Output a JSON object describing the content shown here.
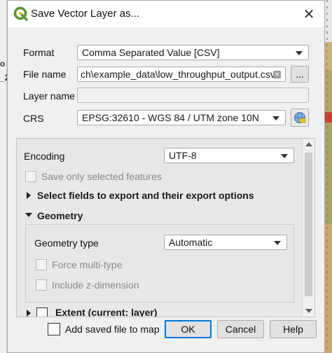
{
  "window": {
    "title": "Save Vector Layer as..."
  },
  "background": {
    "left_fragments": [
      "o",
      "_2"
    ]
  },
  "fields": {
    "format_label": "Format",
    "format_value": "Comma Separated Value [CSV]",
    "filename_label": "File name",
    "filename_value": "ch\\example_data\\low_throughput_output.csv",
    "browse_label": "...",
    "layername_label": "Layer name",
    "layername_value": "",
    "crs_label": "CRS",
    "crs_value": "EPSG:32610 - WGS 84 / UTM zone 10N"
  },
  "options": {
    "encoding_label": "Encoding",
    "encoding_value": "UTF-8",
    "save_selected_label": "Save only selected features",
    "select_fields_label": "Select fields to export and their export options",
    "geometry_label": "Geometry",
    "geometry_type_label": "Geometry type",
    "geometry_type_value": "Automatic",
    "force_multi_label": "Force multi-type",
    "include_z_label": "Include z-dimension",
    "extent_label": "Extent (current: layer)"
  },
  "footer": {
    "add_saved_label": "Add saved file to map",
    "ok_label": "OK",
    "cancel_label": "Cancel",
    "help_label": "Help"
  },
  "colors": {
    "qgis_green": "#589632",
    "qgis_yellow": "#f0c800",
    "accent": "#0078d7"
  }
}
